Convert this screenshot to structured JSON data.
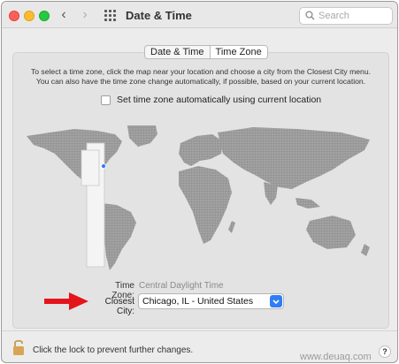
{
  "window": {
    "title": "Date & Time",
    "search_placeholder": "Search"
  },
  "tabs": [
    {
      "label": "Date & Time",
      "active": false
    },
    {
      "label": "Time Zone",
      "active": true
    }
  ],
  "time_zone_pane": {
    "instructions": [
      "To select a time zone, click the map near your location and choose a city from the Closest City menu.",
      "You can also have the time zone change automatically, if possible, based on your current location."
    ],
    "auto_checkbox": {
      "label": "Set time zone automatically using current location",
      "checked": false
    },
    "time_zone_label": "Time Zone:",
    "time_zone_value": "Central Daylight Time",
    "closest_city_label": "Closest City:",
    "closest_city_value": "Chicago, IL - United States"
  },
  "footer": {
    "lock_text": "Click the lock to prevent further changes.",
    "help_label": "?"
  },
  "watermark": "www.deuaq.com",
  "colors": {
    "accent": "#2f7cf6",
    "annotation_arrow": "#e3141b",
    "map_land": "#9b9b9b",
    "selected_zone": "#f4f4f4"
  },
  "icons": {
    "back": "chevron-left-icon",
    "forward": "chevron-right-icon",
    "grid": "grid-icon",
    "search": "magnifier-icon",
    "lock": "lock-icon",
    "help": "help-icon"
  }
}
